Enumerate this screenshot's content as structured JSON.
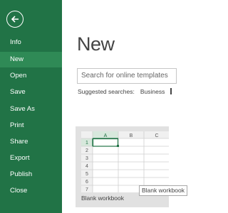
{
  "sidebar": {
    "back_label": "Back",
    "items": [
      {
        "label": "Info"
      },
      {
        "label": "New",
        "active": true
      },
      {
        "label": "Open"
      },
      {
        "label": "Save"
      },
      {
        "label": "Save As"
      },
      {
        "label": "Print"
      },
      {
        "label": "Share"
      },
      {
        "label": "Export"
      },
      {
        "label": "Publish"
      },
      {
        "label": "Close"
      }
    ]
  },
  "main": {
    "title": "New",
    "search": {
      "placeholder": "Search for online templates"
    },
    "suggested": {
      "label": "Suggested searches:",
      "items": [
        "Business"
      ]
    },
    "template": {
      "label": "Blank workbook",
      "tooltip": "Blank workbook",
      "columns": [
        "A",
        "B",
        "C"
      ],
      "rows": [
        "1",
        "2",
        "3",
        "4",
        "5",
        "6",
        "7"
      ],
      "selected_cell": "A1"
    }
  },
  "colors": {
    "accent": "#217346",
    "accent_active": "#2f8a56",
    "card_bg": "#e1e1e1"
  },
  "icons": {
    "back": "back-arrow-circle-icon"
  }
}
